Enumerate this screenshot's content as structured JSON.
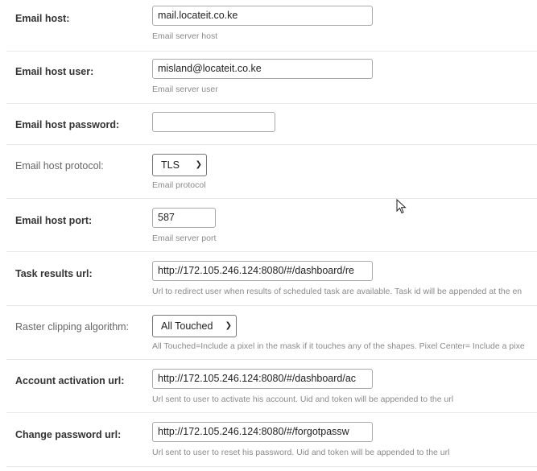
{
  "fields": {
    "email_host": {
      "label": "Email host:",
      "value": "mail.locateit.co.ke",
      "help": "Email server host"
    },
    "email_host_user": {
      "label": "Email host user:",
      "value": "misland@locateit.co.ke",
      "help": "Email server user"
    },
    "email_host_password": {
      "label": "Email host password:",
      "value": ""
    },
    "email_host_protocol": {
      "label": "Email host protocol:",
      "value": "TLS",
      "help": "Email protocol"
    },
    "email_host_port": {
      "label": "Email host port:",
      "value": "587",
      "help": "Email server port"
    },
    "task_results_url": {
      "label": "Task results url:",
      "value": "http://172.105.246.124:8080/#/dashboard/re",
      "help": "Url to redirect user when results of scheduled task are available. Task id will be appended at the en"
    },
    "raster_clipping_algorithm": {
      "label": "Raster clipping algorithm:",
      "value": "All Touched",
      "help": "All Touched=Include a pixel in the mask if it touches any of the shapes. Pixel Center= Include a pixe"
    },
    "account_activation_url": {
      "label": "Account activation url:",
      "value": "http://172.105.246.124:8080/#/dashboard/ac",
      "help": "Url sent to user to activate his account. Uid and token will be appended to the url"
    },
    "change_password_url": {
      "label": "Change password url:",
      "value": "http://172.105.246.124:8080/#/forgotpassw",
      "help": "Url sent to user to reset his password. Uid and token will be appended to the url"
    }
  },
  "icons": {
    "dropdown": "chevron-down-icon",
    "cursor": "mouse-pointer-icon"
  }
}
